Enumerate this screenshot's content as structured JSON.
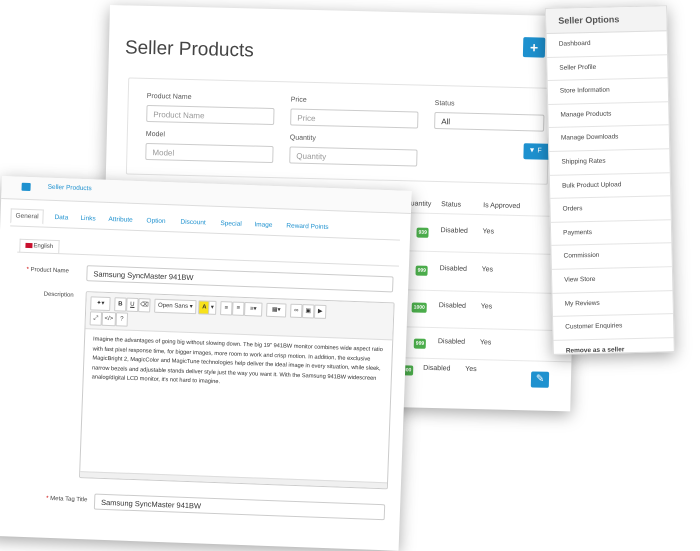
{
  "back": {
    "title": "Seller Products",
    "add_label": "+",
    "filter_button_label": "F",
    "filters": {
      "product_name": {
        "label": "Product Name",
        "placeholder": "Product Name"
      },
      "price": {
        "label": "Price",
        "placeholder": "Price"
      },
      "status": {
        "label": "Status",
        "value": "All"
      },
      "model": {
        "label": "Model",
        "placeholder": "Model"
      },
      "quantity": {
        "label": "Quantity",
        "placeholder": "Quantity"
      }
    },
    "columns": [
      "Quantity",
      "Status",
      "Is Approved"
    ],
    "rows": [
      {
        "quantity": "939",
        "status": "Disabled",
        "approved": "Yes"
      },
      {
        "quantity": "999",
        "status": "Disabled",
        "approved": "Yes"
      },
      {
        "quantity": "1000",
        "status": "Disabled",
        "approved": "Yes"
      },
      {
        "quantity": "999",
        "status": "Disabled",
        "approved": "Yes"
      },
      {
        "quantity": "1000",
        "status": "Disabled",
        "approved": "Yes"
      }
    ],
    "edit_icon": "pencil-icon",
    "accent_color": "#1e91cf",
    "badge_color": "#4cae4c"
  },
  "menu": {
    "title": "Seller Options",
    "items": [
      "Dashboard",
      "Seller Profile",
      "Store Information",
      "Manage Products",
      "Manage Downloads",
      "Shipping Rates",
      "Bulk Product Upload",
      "Orders",
      "Payments",
      "Commission",
      "View Store",
      "My Reviews",
      "Customer Enquiries"
    ],
    "last_item": "Remove as a seller"
  },
  "front": {
    "breadcrumb": "Seller Products",
    "home_icon": "home-icon",
    "tabs": [
      "General",
      "Data",
      "Links",
      "Attribute",
      "Option",
      "Discount",
      "Special",
      "Image",
      "Reward Points"
    ],
    "active_tab": "General",
    "language_tab": "English",
    "product_name_label": "Product Name",
    "product_name_value": "Samsung SyncMaster 941BW",
    "description_label": "Description",
    "font_select": "Open Sans",
    "toolbar_buttons": {
      "bold": "B",
      "underline": "U",
      "code": "</>",
      "help": "?"
    },
    "description_text": "Imagine the advantages of going big without slowing down. The big 19\" 941BW monitor combines wide aspect ratio with fast pixel response time, for bigger images, more room to work and crisp motion. In addition, the exclusive MagicBright 2, MagicColor and MagicTune technologies help deliver the ideal image in every situation, while sleek, narrow bezels and adjustable stands deliver style just the way you want it. With the Samsung 941BW widescreen analog/digital LCD monitor, it's not hard to imagine.",
    "meta_title_label": "Meta Tag Title",
    "meta_title_value": "Samsung SyncMaster 941BW"
  }
}
